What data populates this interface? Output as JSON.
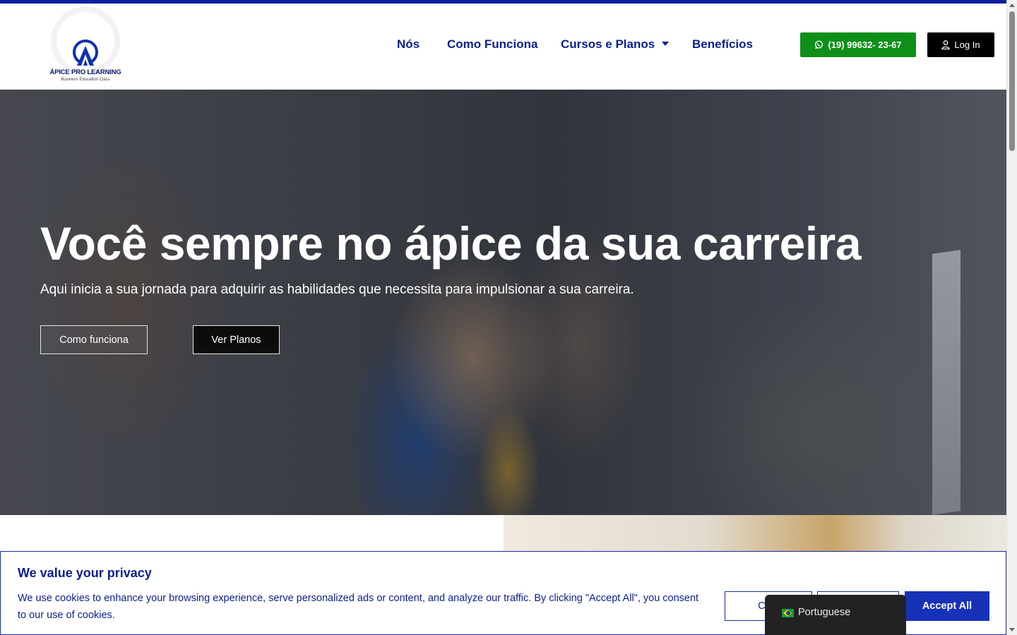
{
  "brand": {
    "name": "ÁPICE PRO LEARNING",
    "tagline": "Business Education Class",
    "colors": {
      "primary": "#0b1f8f",
      "whatsapp": "#0f8f1a",
      "accept": "#1732b8"
    }
  },
  "nav": {
    "items": [
      {
        "label": "Nós"
      },
      {
        "label": "Como Funciona"
      },
      {
        "label": "Cursos e Planos",
        "has_dropdown": true
      },
      {
        "label": "Benefícios"
      }
    ]
  },
  "header": {
    "whatsapp_label": "(19) 99632- 23-67",
    "whatsapp_icon": "whatsapp-icon",
    "login_label": "Log In",
    "login_icon": "user-icon"
  },
  "hero": {
    "title": "Você sempre no ápice da sua carreira",
    "subtitle": "Aqui inicia a sua jornada para adquirir as habilidades que necessita para impulsionar a sua carreira.",
    "btn_how": "Como funciona",
    "btn_plans": "Ver Planos"
  },
  "cookie": {
    "title": "We value your privacy",
    "text": "We use cookies to enhance your browsing experience, serve personalized ads or content, and analyze our traffic. By clicking \"Accept All\", you consent to our use of cookies.",
    "customise_label": "Cust",
    "reject_label": "",
    "accept_label": "Accept All"
  },
  "language": {
    "current": "Portuguese",
    "flag_icon": "brazil-flag-icon"
  }
}
